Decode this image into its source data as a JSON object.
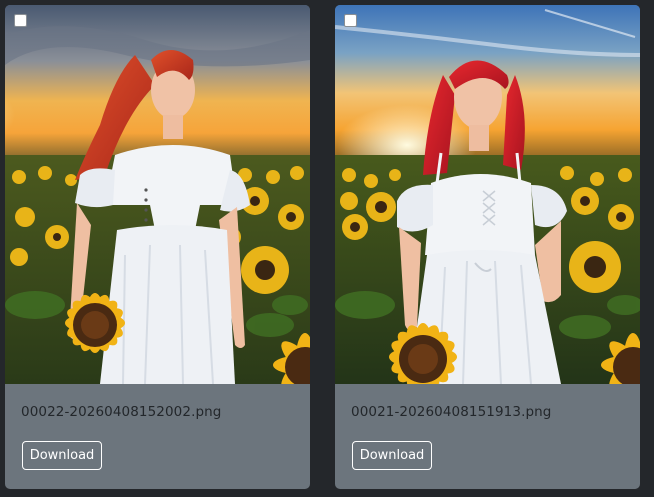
{
  "gallery": {
    "items": [
      {
        "filename": "00022-20260408152002.png",
        "download_label": "Download",
        "selected": false,
        "image_subject": "red-haired woman in white off-shoulder dress in sunflower field at sunset"
      },
      {
        "filename": "00021-20260408151913.png",
        "download_label": "Download",
        "selected": false,
        "image_subject": "red-haired woman in white lace-up dress in sunflower field at sunset"
      }
    ]
  },
  "colors": {
    "page_background": "#24272b",
    "card_background": "#6c757d",
    "filename_text": "#23272b",
    "button_border": "#ffffff",
    "button_text": "#ffffff"
  }
}
